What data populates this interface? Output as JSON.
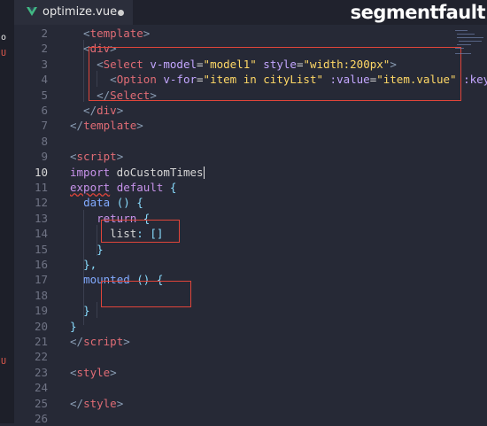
{
  "tab": {
    "filename": "optimize.vue",
    "modified_indicator": "unsaved-dot"
  },
  "watermark": "segmentfault",
  "sidebar_marks": [
    "o",
    "U",
    "U"
  ],
  "active_line": 10,
  "lines": [
    {
      "n": "2",
      "tokens": [
        [
          "t-br",
          "  <"
        ],
        [
          "t-tag",
          "template"
        ],
        [
          "t-br",
          ">"
        ]
      ]
    },
    {
      "n": "2",
      "tokens": [
        [
          "t-br",
          "  <"
        ],
        [
          "t-tag",
          "div"
        ],
        [
          "t-br",
          ">"
        ]
      ]
    },
    {
      "n": "3",
      "tokens": [
        [
          "t-br",
          "    <"
        ],
        [
          "t-tag",
          "Select"
        ],
        [
          "t-id",
          " "
        ],
        [
          "t-attr",
          "v-model"
        ],
        [
          "t-id",
          "="
        ],
        [
          "t-str",
          "\"model1\""
        ],
        [
          "t-id",
          " "
        ],
        [
          "t-attr",
          "style"
        ],
        [
          "t-id",
          "="
        ],
        [
          "t-str",
          "\"width:200px\""
        ],
        [
          "t-br",
          ">"
        ]
      ]
    },
    {
      "n": "4",
      "tokens": [
        [
          "t-br",
          "      <"
        ],
        [
          "t-tag",
          "Option"
        ],
        [
          "t-id",
          " "
        ],
        [
          "t-attr",
          "v-for"
        ],
        [
          "t-id",
          "="
        ],
        [
          "t-str",
          "\"item in cityList\""
        ],
        [
          "t-id",
          " "
        ],
        [
          "t-attr",
          ":value"
        ],
        [
          "t-id",
          "="
        ],
        [
          "t-str",
          "\"item.value\""
        ],
        [
          "t-id",
          " "
        ],
        [
          "t-attr",
          ":key"
        ]
      ]
    },
    {
      "n": "5",
      "tokens": [
        [
          "t-br",
          "    </"
        ],
        [
          "t-tag",
          "Select"
        ],
        [
          "t-br",
          ">"
        ]
      ]
    },
    {
      "n": "6",
      "tokens": [
        [
          "t-br",
          "  </"
        ],
        [
          "t-tag",
          "div"
        ],
        [
          "t-br",
          ">"
        ]
      ]
    },
    {
      "n": "7",
      "tokens": [
        [
          "t-br",
          "</"
        ],
        [
          "t-tag",
          "template"
        ],
        [
          "t-br",
          ">"
        ]
      ]
    },
    {
      "n": "8",
      "tokens": []
    },
    {
      "n": "9",
      "tokens": [
        [
          "t-br",
          "<"
        ],
        [
          "t-tag",
          "script"
        ],
        [
          "t-br",
          ">"
        ]
      ]
    },
    {
      "n": "10",
      "tokens": [
        [
          "t-kw",
          "import"
        ],
        [
          "t-id",
          " doCustomTimes"
        ],
        [
          "cursor",
          ""
        ]
      ]
    },
    {
      "n": "11",
      "tokens": [
        [
          "t-kw squiggle",
          "export"
        ],
        [
          "t-id",
          " "
        ],
        [
          "t-kw",
          "default"
        ],
        [
          "t-id",
          " "
        ],
        [
          "t-pun",
          "{"
        ]
      ]
    },
    {
      "n": "12",
      "tokens": [
        [
          "t-id",
          "  "
        ],
        [
          "t-fn",
          "data"
        ],
        [
          "t-id",
          " "
        ],
        [
          "t-pun",
          "()"
        ],
        [
          "t-id",
          " "
        ],
        [
          "t-pun",
          "{"
        ]
      ]
    },
    {
      "n": "13",
      "tokens": [
        [
          "t-id",
          "    "
        ],
        [
          "t-kw",
          "return"
        ],
        [
          "t-id",
          " "
        ],
        [
          "t-pun",
          "{"
        ]
      ]
    },
    {
      "n": "14",
      "tokens": [
        [
          "t-id",
          "      list"
        ],
        [
          "t-pun",
          ":"
        ],
        [
          "t-id",
          " "
        ],
        [
          "t-pun",
          "[]"
        ]
      ]
    },
    {
      "n": "15",
      "tokens": [
        [
          "t-id",
          "    "
        ],
        [
          "t-pun",
          "}"
        ]
      ]
    },
    {
      "n": "16",
      "tokens": [
        [
          "t-id",
          "  "
        ],
        [
          "t-pun",
          "},"
        ]
      ]
    },
    {
      "n": "17",
      "tokens": [
        [
          "t-id",
          "  "
        ],
        [
          "t-fn",
          "mounted"
        ],
        [
          "t-id",
          " "
        ],
        [
          "t-pun",
          "()"
        ],
        [
          "t-id",
          " "
        ],
        [
          "t-pun",
          "{"
        ]
      ]
    },
    {
      "n": "18",
      "tokens": []
    },
    {
      "n": "19",
      "tokens": [
        [
          "t-id",
          "  "
        ],
        [
          "t-pun",
          "}"
        ]
      ]
    },
    {
      "n": "20",
      "tokens": [
        [
          "t-pun",
          "}"
        ]
      ]
    },
    {
      "n": "21",
      "tokens": [
        [
          "t-br",
          "</"
        ],
        [
          "t-tag",
          "script"
        ],
        [
          "t-br",
          ">"
        ]
      ]
    },
    {
      "n": "22",
      "tokens": []
    },
    {
      "n": "23",
      "tokens": [
        [
          "t-br",
          "<"
        ],
        [
          "t-tag",
          "style"
        ],
        [
          "t-br",
          ">"
        ]
      ]
    },
    {
      "n": "24",
      "tokens": []
    },
    {
      "n": "25",
      "tokens": [
        [
          "t-br",
          "</"
        ],
        [
          "t-tag",
          "style"
        ],
        [
          "t-br",
          ">"
        ]
      ]
    },
    {
      "n": "26",
      "tokens": []
    }
  ],
  "annotations": [
    "select-block-highlight",
    "list-value-highlight",
    "mounted-body-highlight"
  ]
}
